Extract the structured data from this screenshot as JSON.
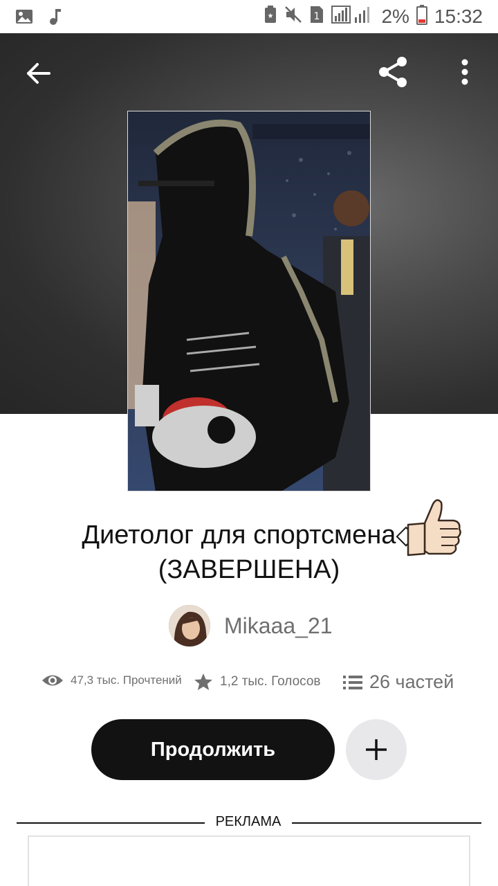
{
  "status_bar": {
    "battery": "2%",
    "time": "15:32",
    "sim_slot": "1",
    "icons": [
      "image-icon",
      "music-note-icon",
      "battery-saver-icon",
      "mute-icon",
      "sim-icon",
      "signal-icon",
      "battery-icon"
    ]
  },
  "toolbar": {
    "back_icon": "arrow-left-icon",
    "share_icon": "share-icon",
    "more_icon": "more-vertical-icon"
  },
  "story": {
    "title_line1": "Диетолог для спортсмена◇",
    "title_line2": "(ЗАВЕРШЕНА)",
    "title_emoji": "thumbs-up-emoji",
    "author": "Mikaaa_21"
  },
  "stats": {
    "reads": "47,3 тыс. Прочтений",
    "votes": "1,2 тыс. Голосов",
    "parts": "26 частей"
  },
  "actions": {
    "continue_label": "Продолжить",
    "add_icon": "plus-icon"
  },
  "ad": {
    "label": "РЕКЛАМА"
  },
  "colors": {
    "primary_button": "#121212",
    "secondary_button": "#e8e8ea",
    "muted_text": "#6f6f6f",
    "hero_background": "#3a3a3a"
  }
}
